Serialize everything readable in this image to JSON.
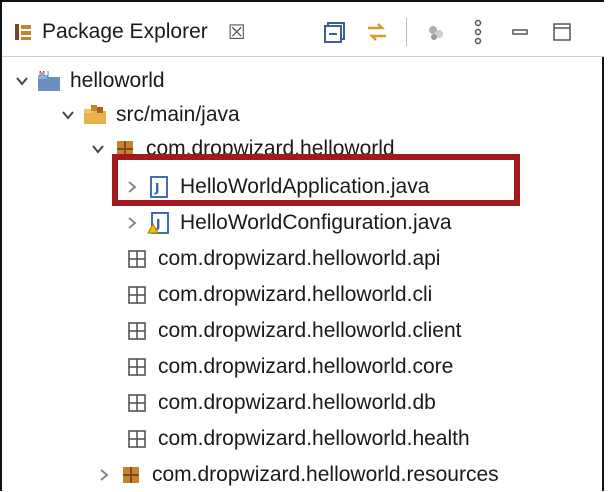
{
  "view": {
    "title": "Package Explorer",
    "close_glyph": "☒"
  },
  "toolbar": {
    "buttons": [
      "collapse-all-icon",
      "link-with-editor-icon",
      "filter-icon",
      "view-menu-icon",
      "minimize-icon",
      "maximize-icon"
    ]
  },
  "tree": {
    "items": [
      {
        "label": "helloworld",
        "icon": "maven-project-icon",
        "expanded": true
      },
      {
        "label": "src/main/java",
        "icon": "source-folder-icon",
        "expanded": true
      },
      {
        "label": "com.dropwizard.helloworld",
        "icon": "package-icon",
        "expanded": true
      },
      {
        "label": "HelloWorldApplication.java",
        "icon": "java-file-icon",
        "expanded": false
      },
      {
        "label": "HelloWorldConfiguration.java",
        "icon": "java-file-warning-icon",
        "expanded": false
      },
      {
        "label": "com.dropwizard.helloworld.api",
        "icon": "empty-package-icon"
      },
      {
        "label": "com.dropwizard.helloworld.cli",
        "icon": "empty-package-icon"
      },
      {
        "label": "com.dropwizard.helloworld.client",
        "icon": "empty-package-icon"
      },
      {
        "label": "com.dropwizard.helloworld.core",
        "icon": "empty-package-icon"
      },
      {
        "label": "com.dropwizard.helloworld.db",
        "icon": "empty-package-icon"
      },
      {
        "label": "com.dropwizard.helloworld.health",
        "icon": "empty-package-icon"
      },
      {
        "label": "com.dropwizard.helloworld.resources",
        "icon": "package-icon",
        "expanded": false
      }
    ]
  },
  "colors": {
    "highlight_border": "#a11a1f",
    "package_brown": "#b5651d",
    "java_blue": "#2e5fa6"
  }
}
